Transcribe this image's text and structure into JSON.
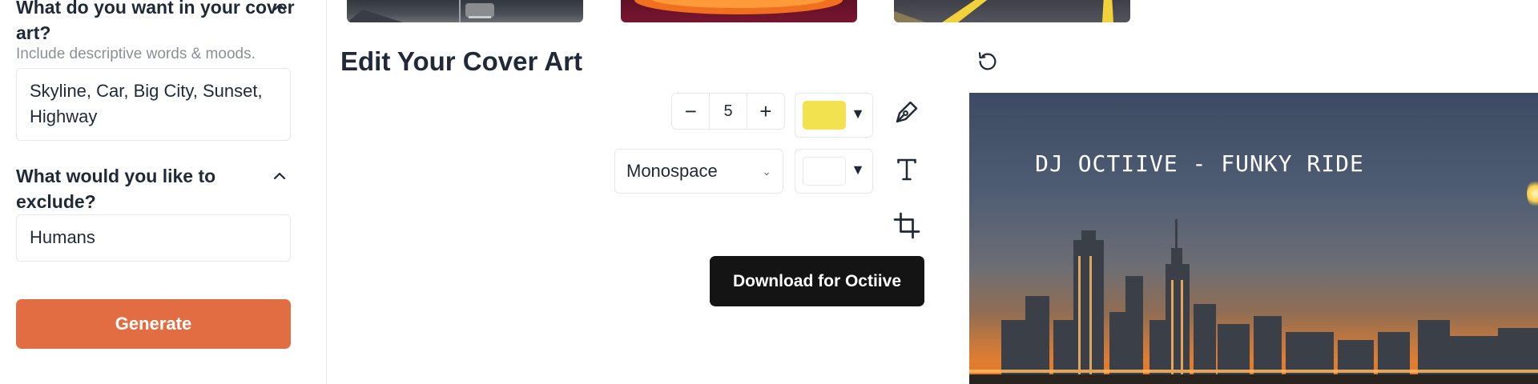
{
  "sidebar": {
    "question1": "What do you want in your cover art?",
    "hint1": "Include descriptive words & moods.",
    "include_value": "Skyline, Car, Big City, Sunset, Highway",
    "question2": "What would you like to exclude?",
    "exclude_value": "Humans",
    "generate_label": "Generate"
  },
  "editor": {
    "title": "Edit Your Cover Art",
    "stroke_size": "5",
    "decrement_label": "−",
    "increment_label": "+",
    "brush_color": "#f2e24f",
    "text_color": "#ffffff",
    "font_family_selected": "Monospace",
    "download_label": "Download for Octiive"
  },
  "canvas": {
    "text": "DJ OCTIIVE - FUNKY RIDE"
  },
  "icons": {
    "collapse": "chevron-up-icon",
    "pen": "pen-icon",
    "text": "text-icon",
    "crop": "crop-icon",
    "reset": "reset-icon"
  },
  "colors": {
    "generate_button": "#e36d43",
    "download_button": "#141414"
  }
}
